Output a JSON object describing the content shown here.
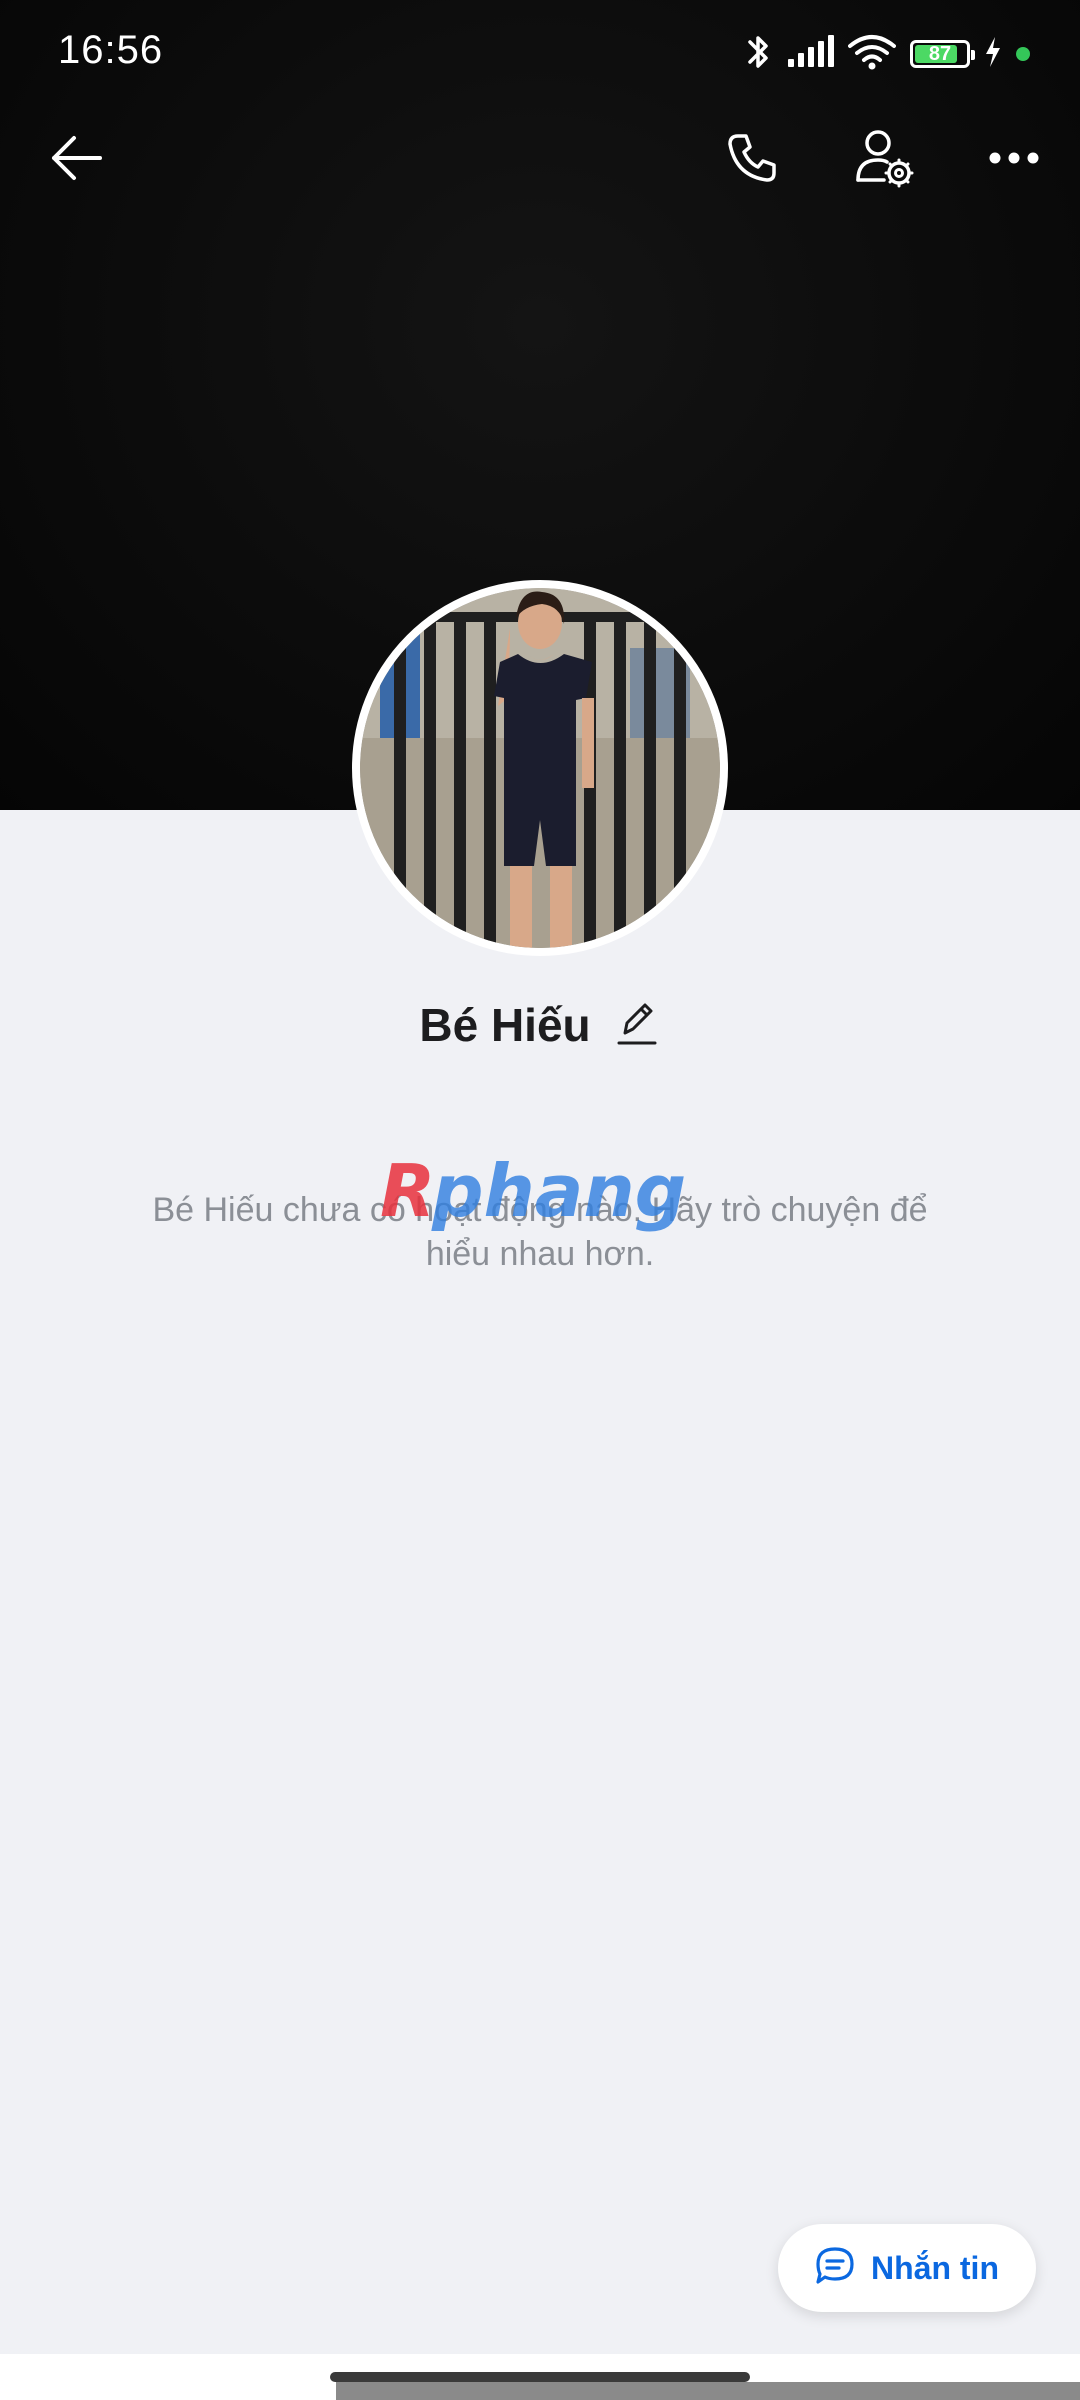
{
  "status_bar": {
    "time": "16:56",
    "battery_level": "87",
    "icons": [
      "bluetooth-icon",
      "signal-icon",
      "wifi-icon",
      "battery-icon",
      "charging-icon",
      "privacy-dot"
    ]
  },
  "header": {
    "actions": [
      "back-arrow-icon",
      "phone-call-icon",
      "user-settings-icon",
      "more-options-icon"
    ]
  },
  "profile": {
    "name": "Bé Hiếu",
    "edit_icon": "pencil-icon"
  },
  "timeline": {
    "empty_message": "Bé Hiếu chưa có hoạt động nào. Hãy trò chuyện để hiểu nhau hơn."
  },
  "watermark": {
    "text": "Rphang"
  },
  "fab": {
    "label": "Nhắn tin",
    "icon": "chat-bubble-icon"
  },
  "colors": {
    "accent": "#0b68e0",
    "background": "#f0f1f5",
    "cover": "#0b0b0b",
    "battery_fill": "#4cd964"
  }
}
